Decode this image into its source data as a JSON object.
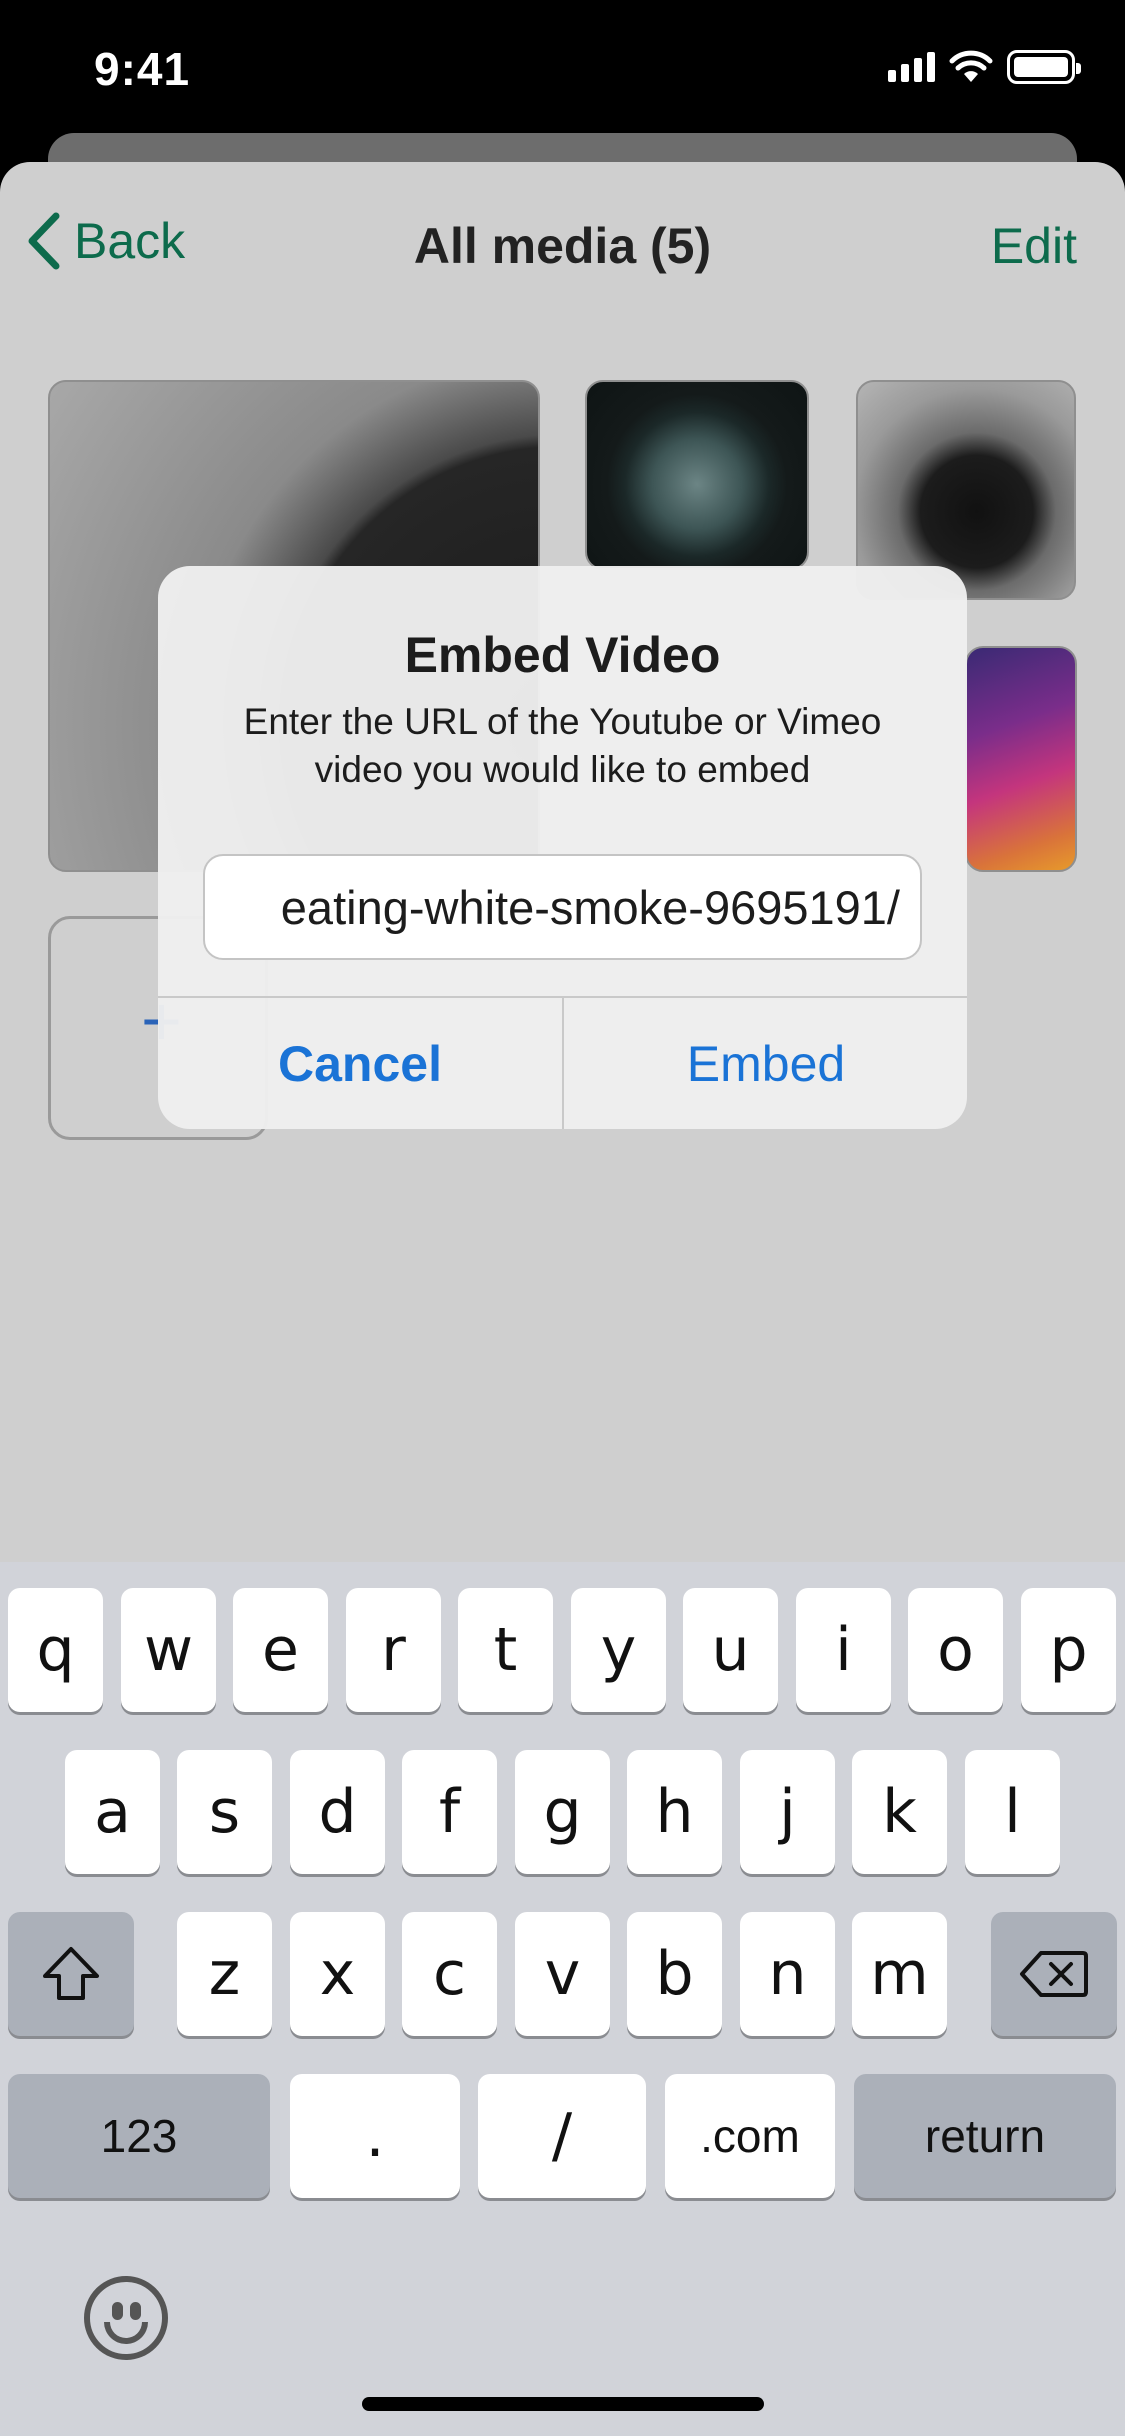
{
  "status_bar": {
    "time": "9:41",
    "icons": [
      "signal-icon",
      "wifi-icon",
      "battery-icon"
    ]
  },
  "nav": {
    "back_label": "Back",
    "title": "All media (5)",
    "edit_label": "Edit"
  },
  "media": {
    "items": [
      "media-dark-sphere",
      "media-moon-sphere",
      "media-smoke-sphere",
      "media-gradient"
    ],
    "add_label": "+"
  },
  "alert": {
    "title": "Embed Video",
    "message": "Enter the URL of the Youtube or Vimeo video you would like to embed",
    "input_value": "eating-white-smoke-9695191/",
    "cancel_label": "Cancel",
    "embed_label": "Embed"
  },
  "keyboard": {
    "row1": [
      "q",
      "w",
      "e",
      "r",
      "t",
      "y",
      "u",
      "i",
      "o",
      "p"
    ],
    "row2": [
      "a",
      "s",
      "d",
      "f",
      "g",
      "h",
      "j",
      "k",
      "l"
    ],
    "row3": [
      "z",
      "x",
      "c",
      "v",
      "b",
      "n",
      "m"
    ],
    "num_label": "123",
    "dot_label": ".",
    "slash_label": "/",
    "dotcom_label": ".com",
    "return_label": "return"
  },
  "colors": {
    "accent_green": "#0d6b4c",
    "alert_blue": "#1a73d6"
  }
}
